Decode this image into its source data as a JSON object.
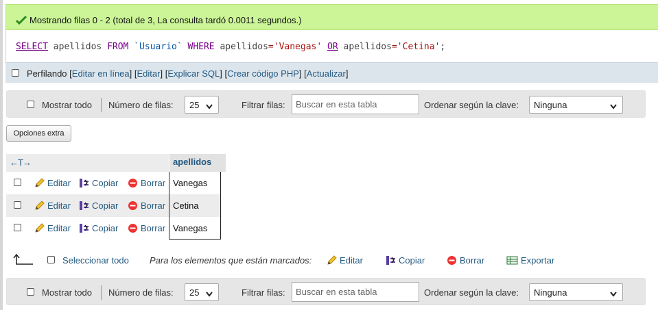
{
  "message": {
    "text": "Mostrando filas 0 - 2 (total de 3, La consulta tardó 0.0011 segundos.)"
  },
  "sql": {
    "select": "SELECT",
    "column": "apellidos",
    "from": "FROM",
    "table": "`Usuario`",
    "where": "WHERE",
    "col1": "apellidos",
    "eq1": "=",
    "val1": "'Vanegas'",
    "or": "OR",
    "col2": "apellidos",
    "eq2": "=",
    "val2": "'Cetina'",
    "end": ";"
  },
  "profiling": {
    "label": "Perfilando",
    "bracket_open": "[",
    "bracket_close": "]",
    "links": [
      "Editar en línea",
      "Editar",
      "Explicar SQL",
      "Crear código PHP",
      "Actualizar"
    ]
  },
  "nav": {
    "show_all": "Mostrar todo",
    "rows_label": "Número de filas:",
    "rows_value": "25",
    "filter_label": "Filtrar filas:",
    "filter_placeholder": "Buscar en esta tabla",
    "sort_label": "Ordenar según la clave:",
    "sort_value": "Ninguna"
  },
  "extra_options": "Opciones extra",
  "table": {
    "header_arrows": "←T→",
    "column": "apellidos",
    "actions": {
      "edit": "Editar",
      "copy": "Copiar",
      "delete": "Borrar"
    },
    "rows": [
      {
        "apellidos": "Vanegas"
      },
      {
        "apellidos": "Cetina"
      },
      {
        "apellidos": "Vanegas"
      }
    ]
  },
  "bulk": {
    "select_all": "Seleccionar todo",
    "with_selected": "Para los elementos que están marcados:",
    "edit": "Editar",
    "copy": "Copiar",
    "delete": "Borrar",
    "export": "Exportar"
  },
  "colors": {
    "success_bg": "#ccf598",
    "link": "#235a81",
    "keyword": "#770088",
    "string": "#aa1111"
  }
}
